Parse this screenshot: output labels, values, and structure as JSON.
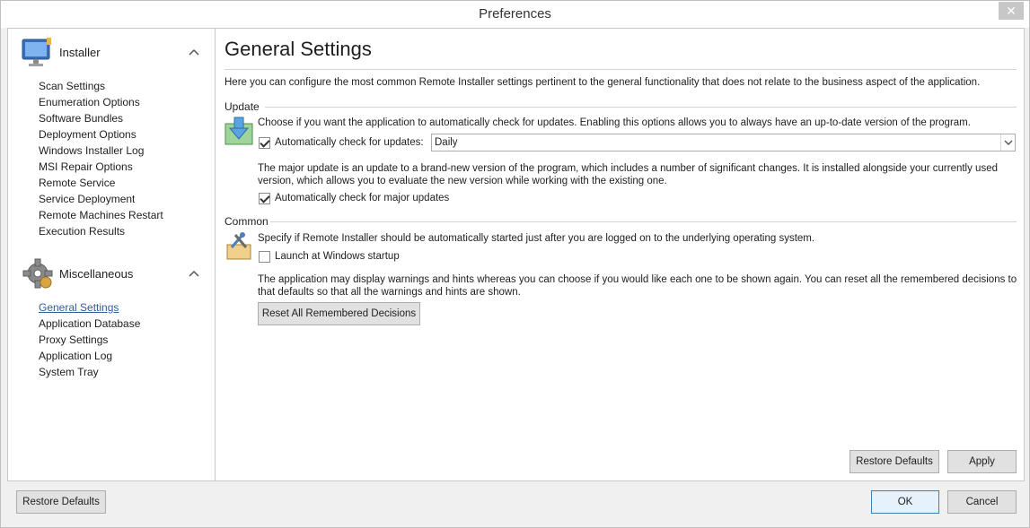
{
  "window": {
    "title": "Preferences",
    "close_glyph": "✕"
  },
  "nav": {
    "groups": [
      {
        "title": "Installer",
        "icon": "monitor-icon",
        "items": [
          "Scan Settings",
          "Enumeration Options",
          "Software Bundles",
          "Deployment Options",
          "Windows Installer Log",
          "MSI Repair Options",
          "Remote Service",
          "Service Deployment",
          "Remote Machines Restart",
          "Execution Results"
        ]
      },
      {
        "title": "Miscellaneous",
        "icon": "gear-icon",
        "items": [
          "General Settings",
          "Application Database",
          "Proxy Settings",
          "Application Log",
          "System Tray"
        ],
        "active_index": 0
      }
    ]
  },
  "content": {
    "title": "General Settings",
    "intro": "Here you can configure the most common Remote Installer settings pertinent to the general functionality that does not relate to the business aspect of the application.",
    "update": {
      "label": "Update",
      "description": "Choose if you want the application to automatically check for updates. Enabling this options allows you to always have an up-to-date version of the program.",
      "auto_check_label": "Automatically check for updates:",
      "auto_check_checked": true,
      "frequency_value": "Daily",
      "major_description": "The major update is an update to a brand-new version of the program, which includes a number of significant changes. It is installed alongside your currently used version, which allows you to evaluate the new version while working with the existing one.",
      "major_label": "Automatically check for major updates",
      "major_checked": true
    },
    "common": {
      "label": "Common",
      "description": "Specify if Remote Installer should be automatically started just after you are logged on to the underlying operating system.",
      "startup_label": "Launch at Windows startup",
      "startup_checked": false,
      "warnings_description": "The application may display warnings and hints whereas you can choose if you would like each one to be shown again. You can reset all the remembered decisions to that defaults so that all the warnings and hints are shown.",
      "reset_button": "Reset All Remembered Decisions"
    },
    "restore_defaults_button": "Restore Defaults",
    "apply_button": "Apply"
  },
  "footer": {
    "restore_defaults_button": "Restore Defaults",
    "ok_button": "OK",
    "cancel_button": "Cancel"
  }
}
